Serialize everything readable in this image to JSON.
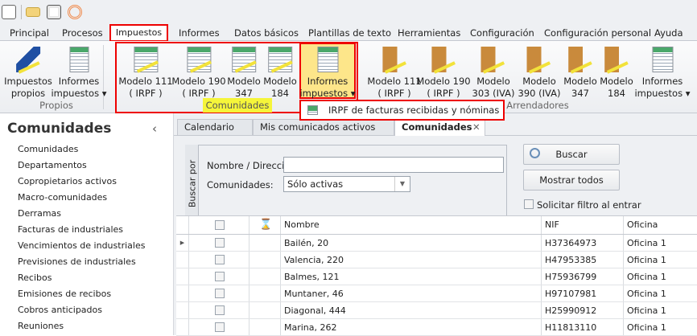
{
  "quick_access": {
    "icons": [
      "app-icon",
      "mail-icon",
      "clipboard-check-icon",
      "signal-icon"
    ]
  },
  "ribbon_tabs": [
    "Principal",
    "Procesos",
    "Impuestos",
    "Informes",
    "Datos básicos",
    "Plantillas de texto",
    "Herramientas",
    "Configuración",
    "Configuración personal",
    "Ayuda"
  ],
  "active_tab": "Impuestos",
  "groups": {
    "propios": {
      "label": "Propios",
      "buttons": [
        {
          "l1": "Impuestos",
          "l2": "propios"
        },
        {
          "l1": "Informes",
          "l2": "impuestos ▾"
        }
      ]
    },
    "comunidades": {
      "label": "Comunidades",
      "buttons": [
        {
          "l1": "Modelo 111",
          "l2": "( IRPF )"
        },
        {
          "l1": "Modelo 190",
          "l2": "( IRPF )"
        },
        {
          "l1": "Modelo",
          "l2": "347"
        },
        {
          "l1": "Modelo",
          "l2": "184"
        },
        {
          "l1": "Informes",
          "l2": "impuestos ▾"
        }
      ]
    },
    "arrendadores": {
      "label": "Arrendadores",
      "buttons": [
        {
          "l1": "Modelo 111",
          "l2": "( IRPF )"
        },
        {
          "l1": "Modelo 190",
          "l2": "( IRPF )"
        },
        {
          "l1": "Modelo",
          "l2": "303 (IVA)"
        },
        {
          "l1": "Modelo",
          "l2": "390 (IVA)"
        },
        {
          "l1": "Modelo",
          "l2": "347"
        },
        {
          "l1": "Modelo",
          "l2": "184"
        },
        {
          "l1": "Informes",
          "l2": "impuestos ▾"
        }
      ]
    }
  },
  "dropdown": {
    "item": "IRPF de facturas recibidas y nóminas"
  },
  "sidebar": {
    "title": "Comunidades",
    "collapse": "‹",
    "items": [
      "Comunidades",
      "Departamentos",
      "Copropietarios activos",
      "Macro-comunidades",
      "Derramas",
      "Facturas de industriales",
      "Vencimientos de industriales",
      "Previsiones de industriales",
      "Recibos",
      "Emisiones de recibos",
      "Cobros anticipados",
      "Reuniones"
    ]
  },
  "doc_tabs": [
    "Calendario",
    "Mis comunicados activos",
    "Comunidades"
  ],
  "close": "✕",
  "search": {
    "group_label": "Buscar por",
    "name_label": "Nombre / Dirección:",
    "name_value": "",
    "com_label": "Comunidades:",
    "com_value": "Sólo activas",
    "buscar": "Buscar",
    "mostrar": "Mostrar todos",
    "solicitar": "Solicitar filtro al entrar"
  },
  "grid": {
    "headers": [
      "Nombre",
      "NIF",
      "Oficina"
    ],
    "rows": [
      [
        "Bailén, 20",
        "H37364973",
        "Oficina 1"
      ],
      [
        "Valencia, 220",
        "H47953385",
        "Oficina 1"
      ],
      [
        "Balmes, 121",
        "H75936799",
        "Oficina 1"
      ],
      [
        "Muntaner, 46",
        "H97107981",
        "Oficina 1"
      ],
      [
        "Diagonal, 444",
        "H25990912",
        "Oficina 1"
      ],
      [
        "Marina, 262",
        "H11813110",
        "Oficina 1"
      ]
    ]
  }
}
